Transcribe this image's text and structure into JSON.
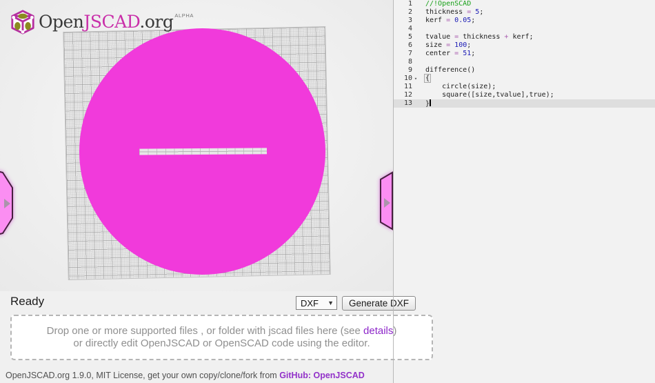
{
  "colors": {
    "accent": "#c92fa9",
    "circle": "#f13adb",
    "tab": "#fb8ef2",
    "link": "#8d26c9"
  },
  "logo": {
    "open": "Open",
    "jscad": "JSCAD",
    "org": ".org",
    "alpha": "ALPHA"
  },
  "status": {
    "ready": "Ready"
  },
  "controls": {
    "format_selected": "DXF",
    "format_caret_icon": "▼",
    "generate_label": "Generate DXF"
  },
  "dropzone": {
    "line1_prefix": "Drop one or more supported files , or folder with jscad files here (see ",
    "details_link": "details",
    "line1_suffix": ")",
    "line2": "or directly edit OpenJSCAD or OpenSCAD code using the editor."
  },
  "footer": {
    "prefix": "OpenJSCAD.org 1.9.0, MIT License, get your own copy/clone/fork from ",
    "github_link": "GitHub: OpenJSCAD"
  },
  "editor": {
    "fold_icon": "▾",
    "active_line": 13,
    "cursor_line": 13,
    "lines": [
      {
        "n": 1,
        "tokens": [
          [
            "c",
            "//!OpenSCAD"
          ]
        ]
      },
      {
        "n": 2,
        "tokens": [
          [
            "p",
            "thickness "
          ],
          [
            "o",
            "="
          ],
          [
            "p",
            " "
          ],
          [
            "num",
            "5"
          ],
          [
            "p",
            ";"
          ]
        ]
      },
      {
        "n": 3,
        "tokens": [
          [
            "p",
            "kerf "
          ],
          [
            "o",
            "="
          ],
          [
            "p",
            " "
          ],
          [
            "num",
            "0.05"
          ],
          [
            "p",
            ";"
          ]
        ]
      },
      {
        "n": 4,
        "tokens": []
      },
      {
        "n": 5,
        "tokens": [
          [
            "p",
            "tvalue "
          ],
          [
            "o",
            "="
          ],
          [
            "p",
            " thickness "
          ],
          [
            "o",
            "+"
          ],
          [
            "p",
            " kerf;"
          ]
        ]
      },
      {
        "n": 6,
        "tokens": [
          [
            "p",
            "size "
          ],
          [
            "o",
            "="
          ],
          [
            "p",
            " "
          ],
          [
            "num",
            "100"
          ],
          [
            "p",
            ";"
          ]
        ]
      },
      {
        "n": 7,
        "tokens": [
          [
            "p",
            "center "
          ],
          [
            "o",
            "="
          ],
          [
            "p",
            " "
          ],
          [
            "num",
            "51"
          ],
          [
            "p",
            ";"
          ]
        ]
      },
      {
        "n": 8,
        "tokens": []
      },
      {
        "n": 9,
        "tokens": [
          [
            "p",
            "difference()"
          ]
        ]
      },
      {
        "n": 10,
        "fold": true,
        "tokens": [
          [
            "b",
            "{"
          ]
        ]
      },
      {
        "n": 11,
        "tokens": [
          [
            "p",
            "    circle(size);"
          ]
        ]
      },
      {
        "n": 12,
        "tokens": [
          [
            "p",
            "    square([size,tvalue],true);"
          ]
        ]
      },
      {
        "n": 13,
        "tokens": [
          [
            "p",
            "}"
          ]
        ]
      }
    ]
  }
}
